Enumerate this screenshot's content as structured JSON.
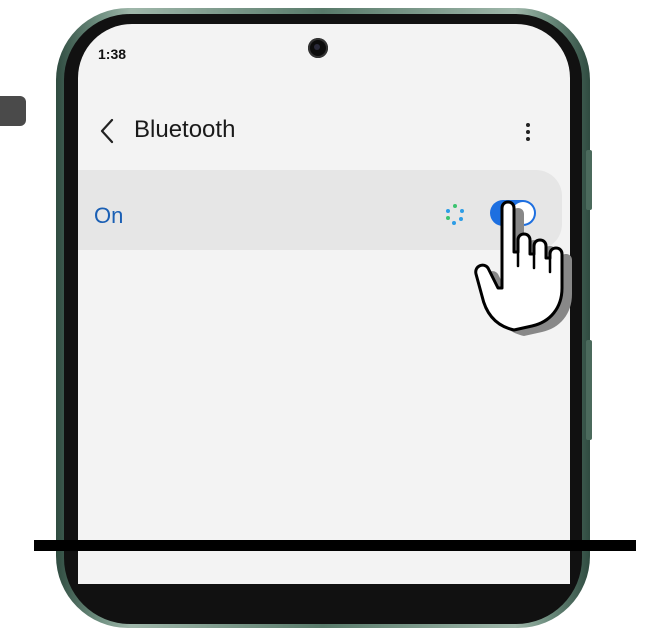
{
  "status_bar": {
    "time": "1:38"
  },
  "header": {
    "title": "Bluetooth",
    "back_icon": "chevron-left-icon",
    "more_icon": "more-vert-icon"
  },
  "bluetooth": {
    "state_label": "On",
    "enabled": true,
    "scanning_icon": "scanning-dots-icon"
  },
  "overlay": {
    "pointer_icon": "hand-pointer-icon"
  },
  "colors": {
    "accent": "#1d6fe0",
    "label_blue": "#1a5fb4",
    "card_bg": "#e6e6e6",
    "screen_bg": "#f3f3f3",
    "frame": "#587a6a"
  }
}
